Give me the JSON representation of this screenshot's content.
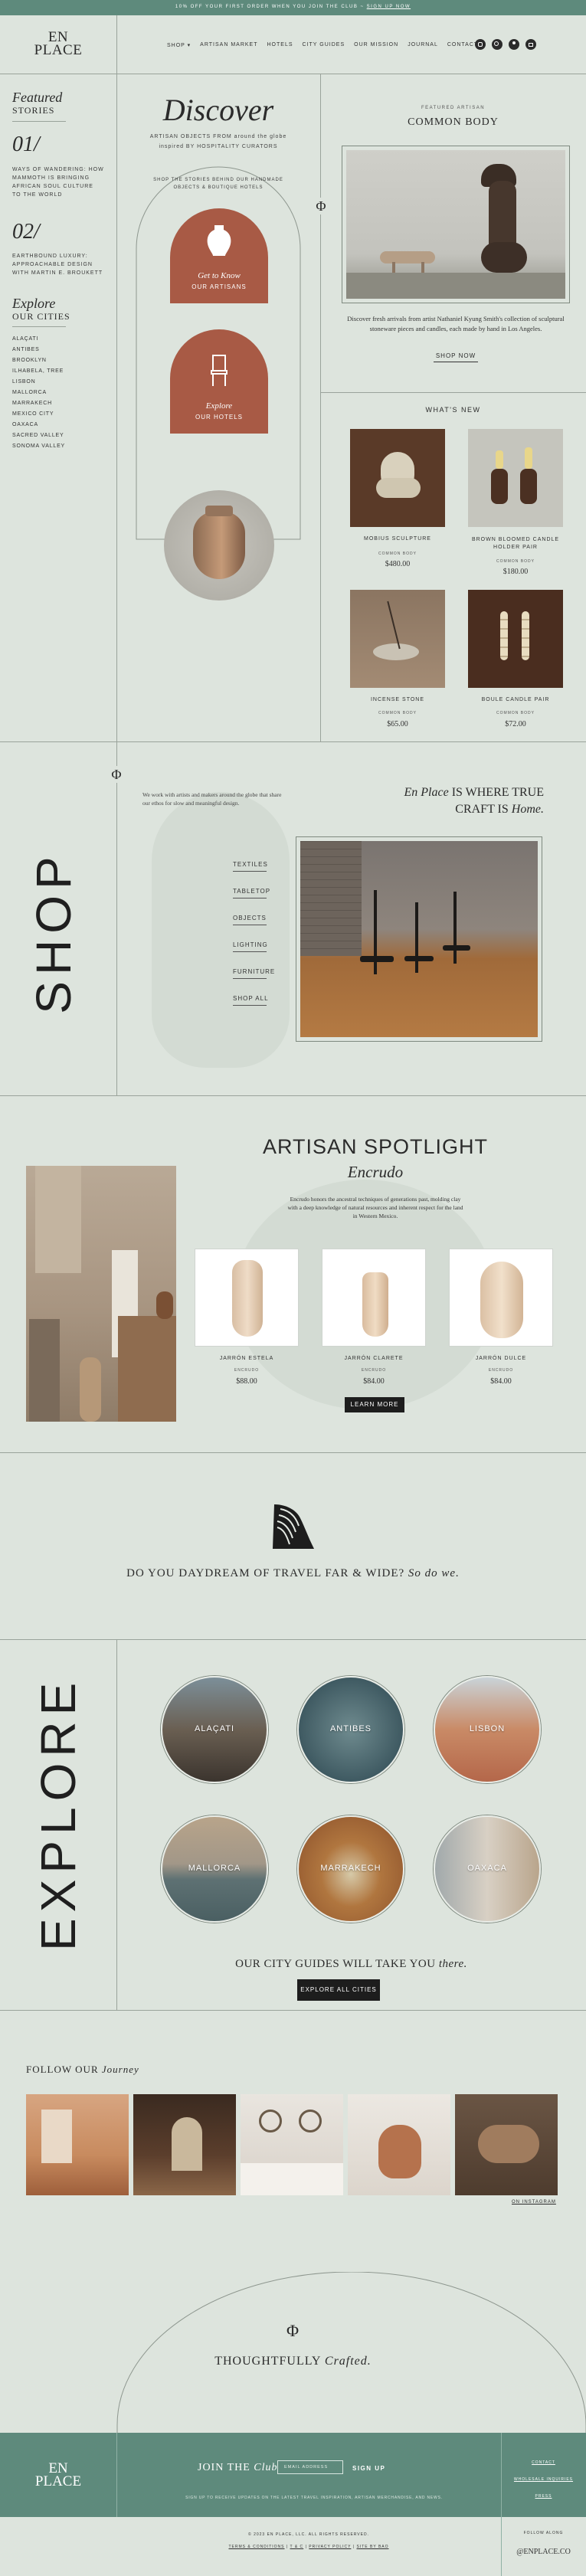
{
  "announcement": {
    "text": "10% OFF YOUR FIRST ORDER WHEN YOU JOIN THE CLUB ~",
    "link": "SIGN UP NOW"
  },
  "brand": {
    "line1": "EN",
    "line2": "PLACE"
  },
  "nav": {
    "items": [
      "SHOP ▾",
      "ARTISAN MARKET",
      "HOTELS",
      "CITY GUIDES",
      "OUR MISSION",
      "JOURNAL",
      "CONTACT"
    ]
  },
  "header_icons": [
    "instagram-icon",
    "search-icon",
    "user-icon",
    "cart-icon"
  ],
  "sidebar": {
    "featured_script": "Featured",
    "featured_caps": "STORIES",
    "story1_num": "01/",
    "story1_text": "WAYS OF WANDERING: HOW MAMMOTH IS BRINGING AFRICAN SOUL CULTURE TO THE WORLD",
    "story2_num": "02/",
    "story2_text": "EARTHBOUND LUXURY: APPROACHABLE DESIGN WITH MARTIN E. BROUKETT",
    "explore_script": "Explore",
    "explore_caps": "OUR CITIES",
    "cities": [
      "ALAÇATI",
      "ANTIBES",
      "BROOKLYN",
      "ILHABELA, TREE",
      "LISBON",
      "MALLORCA",
      "MARRAKECH",
      "MEXICO CITY",
      "OAXACA",
      "SACRED VALLEY",
      "SONOMA VALLEY"
    ]
  },
  "discover": {
    "title": "Discover",
    "subtitle": "ARTISAN OBJECTS FROM around the globe inspired BY HOSPITALITY CURATORS",
    "arc_text": "SHOP THE STORIES BEHIND OUR HANDMADE OBJECTS & BOUTIQUE HOTELS",
    "card1_script": "Get to Know",
    "card1_caps": "OUR ARTISANS",
    "card2_script": "Explore",
    "card2_caps": "OUR HOTELS"
  },
  "featured_artisan": {
    "kicker": "FEATURED ARTISAN",
    "name": "COMMON BODY",
    "description": "Discover fresh arrivals from artist Nathaniel Kyung Smith's collection of sculptural stoneware pieces and candles, each made by hand in Los Angeles.",
    "cta": "SHOP NOW"
  },
  "whats_new": {
    "title": "WHAT'S NEW",
    "products": [
      {
        "name": "MOBIUS SCULPTURE",
        "maker": "COMMON BODY",
        "price": "$480.00"
      },
      {
        "name": "BROWN BLOOMED CANDLE HOLDER PAIR",
        "maker": "COMMON BODY",
        "price": "$180.00"
      },
      {
        "name": "INCENSE STONE",
        "maker": "COMMON BODY",
        "price": "$65.00"
      },
      {
        "name": "BOULE CANDLE PAIR",
        "maker": "COMMON BODY",
        "price": "$72.00"
      }
    ]
  },
  "shop": {
    "vertical": "SHOP",
    "intro": "We work with artists and makers around the globe that share our ethos for slow and meaningful design.",
    "categories": [
      "TEXTILES",
      "TABLETOP",
      "OBJECTS",
      "LIGHTING",
      "FURNITURE",
      "SHOP ALL"
    ],
    "tagline_script1": "En Place",
    "tagline_caps1": "IS WHERE TRUE",
    "tagline_caps2": "CRAFT IS",
    "tagline_script2": "Home."
  },
  "spotlight": {
    "title": "ARTISAN SPOTLIGHT",
    "name": "Encrudo",
    "description": "Encrudo honors the ancestral techniques of generations past, molding clay with a deep knowledge of natural resources and inherent respect for the land in Western Mexico.",
    "products": [
      {
        "name": "JARRÓN ESTELA",
        "maker": "ENCRUDO",
        "price": "$88.00"
      },
      {
        "name": "JARRÓN CLARETE",
        "maker": "ENCRUDO",
        "price": "$84.00"
      },
      {
        "name": "JARRÓN DULCE",
        "maker": "ENCRUDO",
        "price": "$84.00"
      }
    ],
    "cta": "LEARN MORE"
  },
  "daydream": {
    "caps": "DO YOU DAYDREAM OF TRAVEL FAR & WIDE?",
    "script": "So do we."
  },
  "explore": {
    "vertical": "EXPLORE",
    "cities": [
      "ALAÇATI",
      "ANTIBES",
      "LISBON",
      "MALLORCA",
      "MARRAKECH",
      "OAXACA"
    ],
    "caption_caps": "OUR CITY GUIDES WILL TAKE YOU",
    "caption_script": "there.",
    "cta": "EXPLORE ALL CITIES"
  },
  "follow": {
    "caps": "FOLLOW OUR",
    "script": "Journey",
    "link": "ON INSTAGRAM"
  },
  "crafted": {
    "caps": "THOUGHTFULLY",
    "script": "Crafted."
  },
  "footer": {
    "brand1": "EN",
    "brand2": "PLACE",
    "join_caps": "JOIN THE",
    "join_script": "Club",
    "email_placeholder": "EMAIL ADDRESS",
    "signup": "SIGN UP",
    "signup_note": "SIGN UP TO RECEIVE UPDATES ON THE LATEST TRAVEL INSPIRATION, ARTISAN MERCHANDISE, AND NEWS.",
    "links_right": [
      "CONTACT",
      "WHOLESALE INQUIRIES",
      "PRESS"
    ],
    "copyright": "© 2023 EN PLACE, LLC. ALL RIGHTS RESERVED.",
    "legal": [
      "TERMS & CONDITIONS",
      "T & C",
      "PRIVACY POLICY",
      "SITE BY BAO"
    ],
    "follow_label": "FOLLOW ALONG",
    "handle": "@ENPLACE.CO"
  },
  "colors": {
    "terracotta": "#a85a45",
    "sage": "#5e8a7c",
    "background": "#dde4dd",
    "dark": "#1d1d1d"
  }
}
